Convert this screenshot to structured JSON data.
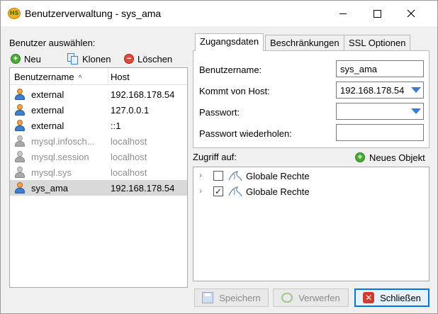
{
  "window": {
    "title": "Benutzerverwaltung - sys_ama",
    "app_icon_text": "HS",
    "controls": {
      "minimize": "minimize",
      "maximize": "maximize",
      "close": "close"
    }
  },
  "left": {
    "select_label": "Benutzer auswählen:",
    "toolbar": {
      "new_label": "Neu",
      "clone_label": "Klonen",
      "delete_label": "Löschen"
    },
    "columns": {
      "user": "Benutzername",
      "host": "Host",
      "sort_indicator": "^"
    },
    "users": [
      {
        "name": "external",
        "host": "192.168.178.54",
        "dim": false,
        "selected": false
      },
      {
        "name": "external",
        "host": "127.0.0.1",
        "dim": false,
        "selected": false
      },
      {
        "name": "external",
        "host": "::1",
        "dim": false,
        "selected": false
      },
      {
        "name": "mysql.infosch...",
        "host": "localhost",
        "dim": true,
        "selected": false
      },
      {
        "name": "mysql.session",
        "host": "localhost",
        "dim": true,
        "selected": false
      },
      {
        "name": "mysql.sys",
        "host": "localhost",
        "dim": true,
        "selected": false
      },
      {
        "name": "sys_ama",
        "host": "192.168.178.54",
        "dim": false,
        "selected": true
      }
    ]
  },
  "tabs": [
    {
      "label": "Zugangsdaten",
      "active": true
    },
    {
      "label": "Beschränkungen",
      "active": false
    },
    {
      "label": "SSL Optionen",
      "active": false
    }
  ],
  "credentials": {
    "username_label": "Benutzername:",
    "username_value": "sys_ama",
    "host_label": "Kommt von Host:",
    "host_value": "192.168.178.54",
    "password_label": "Passwort:",
    "password_value": "",
    "password_repeat_label": "Passwort wiederholen:",
    "password_repeat_value": ""
  },
  "access": {
    "label": "Zugriff auf:",
    "new_object_label": "Neues Objekt",
    "items": [
      {
        "label": "Globale Rechte",
        "checked": false
      },
      {
        "label": "Globale Rechte",
        "checked": true
      }
    ]
  },
  "buttons": {
    "save": "Speichern",
    "discard": "Verwerfen",
    "close": "Schließen"
  },
  "colors": {
    "accent": "#0078d7",
    "dropdown_arrow": "#3a7bd5",
    "selected_row": "#d9d9d9",
    "dim_text": "#8f8f8f"
  }
}
